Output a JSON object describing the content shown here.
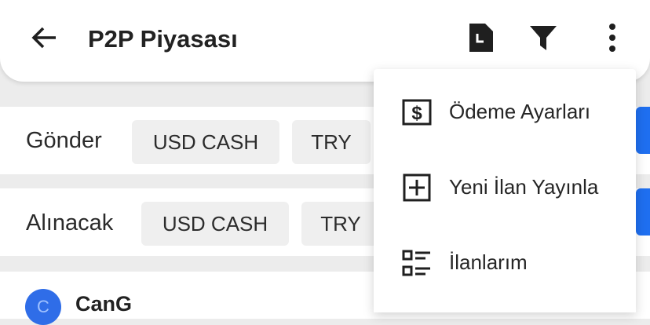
{
  "header": {
    "title": "P2P Piyasası",
    "back_icon": "arrow-left-icon",
    "actions": [
      {
        "icon": "document-icon"
      },
      {
        "icon": "filter-icon"
      },
      {
        "icon": "more-vertical-icon"
      }
    ]
  },
  "send": {
    "label": "Gönder",
    "chips": [
      "USD CASH",
      "TRY"
    ]
  },
  "receive": {
    "label": "Alınacak",
    "chips": [
      "USD CASH",
      "TRY"
    ]
  },
  "list": {
    "items": [
      {
        "avatar_letter": "C",
        "name": "CanG"
      }
    ]
  },
  "menu": {
    "items": [
      {
        "label": "Ödeme Ayarları",
        "icon": "payment-settings-icon"
      },
      {
        "label": "Yeni İlan Yayınla",
        "icon": "add-box-icon"
      },
      {
        "label": "İlanlarım",
        "icon": "list-icon"
      }
    ]
  },
  "colors": {
    "accent": "#1f6ff0",
    "background": "#ececec",
    "chip": "#efefef"
  }
}
